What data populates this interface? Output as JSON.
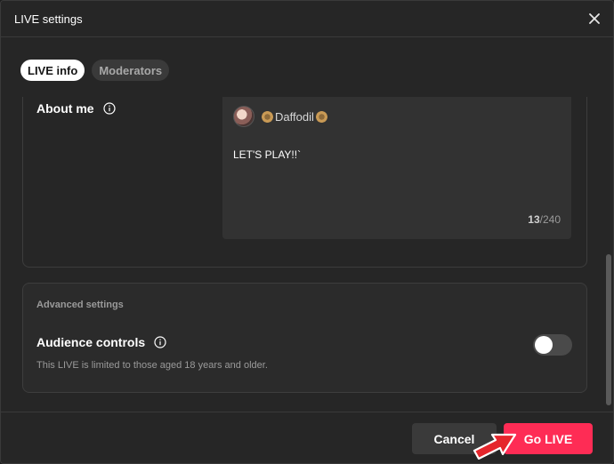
{
  "window": {
    "title": "LIVE settings"
  },
  "tabs": [
    {
      "label": "LIVE info",
      "active": true
    },
    {
      "label": "Moderators",
      "active": false
    }
  ],
  "about": {
    "label": "About me",
    "username": "Daffodil",
    "bio": "LET'S PLAY!!`",
    "count_current": "13",
    "count_max": "/240"
  },
  "advanced": {
    "title": "Advanced settings",
    "audience_label": "Audience controls",
    "audience_desc": "This LIVE is limited to those aged 18 years and older.",
    "audience_enabled": false
  },
  "footer": {
    "cancel_label": "Cancel",
    "go_live_label": "Go LIVE"
  },
  "colors": {
    "accent": "#fe2c55",
    "background": "#262626",
    "annotation_arrow": "#e5262c"
  }
}
